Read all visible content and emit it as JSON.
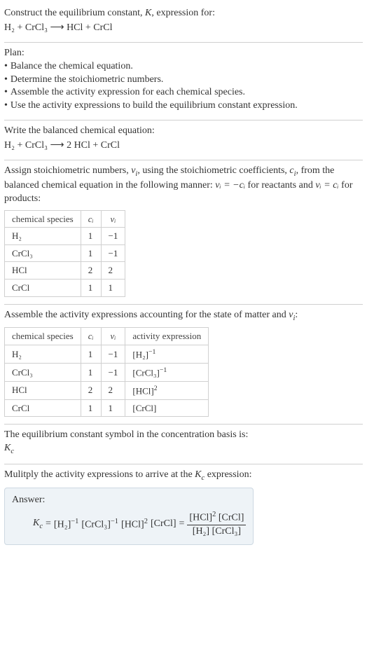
{
  "prompt": {
    "line1": "Construct the equilibrium constant, ",
    "Ksym": "K",
    "line1b": ", expression for:",
    "eq_left": "H",
    "eq": "H₂ + CrCl₃  ⟶  HCl + CrCl"
  },
  "plan": {
    "title": "Plan:",
    "items": [
      "Balance the chemical equation.",
      "Determine the stoichiometric numbers.",
      "Assemble the activity expression for each chemical species.",
      "Use the activity expressions to build the equilibrium constant expression."
    ]
  },
  "balanced": {
    "title": "Write the balanced chemical equation:",
    "eq": "H₂ + CrCl₃  ⟶  2 HCl + CrCl"
  },
  "assign": {
    "text1": "Assign stoichiometric numbers, ",
    "nu": "ν",
    "sub_i": "i",
    "text2": ", using the stoichiometric coefficients, ",
    "c": "c",
    "text3": ", from the balanced chemical equation in the following manner: ",
    "rule1": "νᵢ = −cᵢ",
    "text4": " for reactants and ",
    "rule2": "νᵢ = cᵢ",
    "text5": " for products:",
    "headers": [
      "chemical species",
      "cᵢ",
      "νᵢ"
    ],
    "rows": [
      [
        "H₂",
        "1",
        "−1"
      ],
      [
        "CrCl₃",
        "1",
        "−1"
      ],
      [
        "HCl",
        "2",
        "2"
      ],
      [
        "CrCl",
        "1",
        "1"
      ]
    ]
  },
  "activity": {
    "title": "Assemble the activity expressions accounting for the state of matter and νᵢ:",
    "headers": [
      "chemical species",
      "cᵢ",
      "νᵢ",
      "activity expression"
    ],
    "rows": [
      {
        "s": "H₂",
        "c": "1",
        "n": "−1",
        "ae_base": "[H₂]",
        "ae_exp": "−1"
      },
      {
        "s": "CrCl₃",
        "c": "1",
        "n": "−1",
        "ae_base": "[CrCl₃]",
        "ae_exp": "−1"
      },
      {
        "s": "HCl",
        "c": "2",
        "n": "2",
        "ae_base": "[HCl]",
        "ae_exp": "2"
      },
      {
        "s": "CrCl",
        "c": "1",
        "n": "1",
        "ae_base": "[CrCl]",
        "ae_exp": ""
      }
    ]
  },
  "kbasis": {
    "line": "The equilibrium constant symbol in the concentration basis is:",
    "sym": "K",
    "sub": "c"
  },
  "final": {
    "title": "Mulitply the activity expressions to arrive at the Kc expression:",
    "answer_label": "Answer:",
    "lhs_K": "K",
    "lhs_sub": "c",
    "eq_sign": " = ",
    "prod1_base": "[H₂]",
    "prod1_exp": "−1",
    "prod2_base": "[CrCl₃]",
    "prod2_exp": "−1",
    "prod3_base": "[HCl]",
    "prod3_exp": "2",
    "prod4_base": "[CrCl]",
    "frac_num1_base": "[HCl]",
    "frac_num1_exp": "2",
    "frac_num2": "[CrCl]",
    "frac_den1": "[H₂]",
    "frac_den2": "[CrCl₃]"
  }
}
